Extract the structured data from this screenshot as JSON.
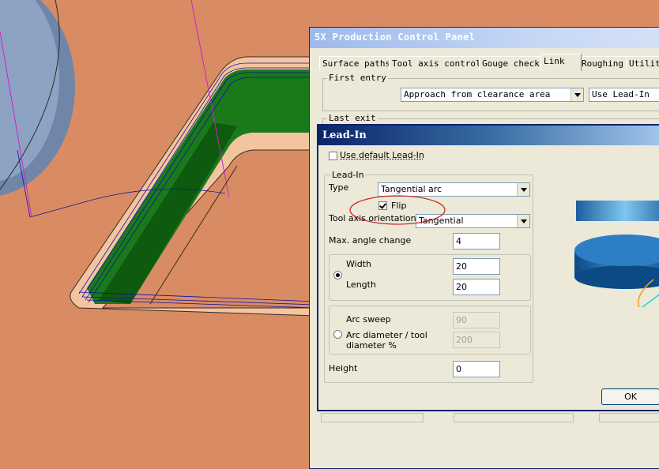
{
  "colors": {
    "background": "#d98c63",
    "toolpath_green": "#1a7a1a",
    "highlight_ellipse": "#cc2020"
  },
  "production_panel": {
    "title": "5X Production Control Panel",
    "tabs": [
      "Surface paths",
      "Tool axis control",
      "Gouge check",
      "Link",
      "Roughing",
      "Utilit"
    ],
    "active_tab": "Link",
    "first_entry": {
      "label": "First entry",
      "approach": "Approach from clearance area",
      "lead_type": "Use Lead-In"
    },
    "last_exit": {
      "label": "Last exit"
    }
  },
  "leadin_dialog": {
    "title": "Lead-In",
    "use_default_label": "Use default Lead-In",
    "use_default_checked": false,
    "group_label": "Lead-In",
    "type_label": "Type",
    "type_value": "Tangential arc",
    "flip_label": "Flip",
    "flip_checked": true,
    "tool_axis_label": "Tool axis orientation",
    "tool_axis_value": "Tangential",
    "max_angle_label": "Max. angle change",
    "max_angle_value": "4",
    "width_label": "Width",
    "width_value": "20",
    "length_label": "Length",
    "length_value": "20",
    "width_length_selected": true,
    "arc_sweep_label": "Arc sweep",
    "arc_sweep_value": "90",
    "arc_diameter_label_1": "Arc diameter / tool",
    "arc_diameter_label_2": "diameter  %",
    "arc_diameter_value": "200",
    "arc_selected": false,
    "height_label": "Height",
    "height_value": "0",
    "ok_label": "OK"
  }
}
